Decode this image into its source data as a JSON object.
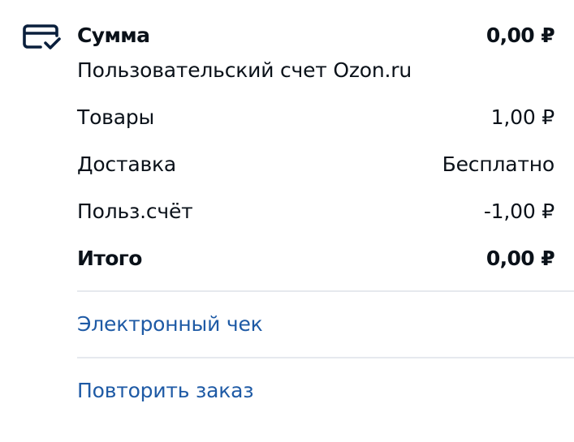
{
  "summary": {
    "title": "Сумма",
    "total_top": "0,00 ₽",
    "payment_method": "Пользовательский счет Ozon.ru"
  },
  "lines": [
    {
      "label": "Товары",
      "value": "1,00 ₽"
    },
    {
      "label": "Доставка",
      "value": "Бесплатно"
    },
    {
      "label": "Польз.счёт",
      "value": "-1,00 ₽"
    }
  ],
  "total": {
    "label": "Итого",
    "value": "0,00 ₽"
  },
  "actions": {
    "receipt": "Электронный чек",
    "repeat": "Повторить заказ"
  },
  "colors": {
    "text": "#0a1119",
    "link": "#1e5aa5",
    "divider": "#e6e9ee",
    "icon": "#0a1f3c"
  },
  "icons": {
    "payment": "card-check-icon"
  }
}
